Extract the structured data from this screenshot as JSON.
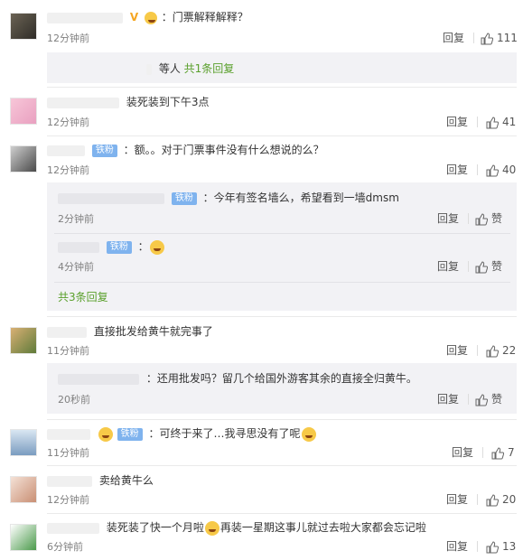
{
  "c1": {
    "text": "：门票解释解释？",
    "time": "12分钟前",
    "reply": "回复",
    "likes": "111",
    "more": "等人",
    "more_link": "共1条回复",
    "v_label": "V"
  },
  "c2": {
    "text": "装死装到下午3点",
    "time": "12分钟前",
    "reply": "回复",
    "likes": "41"
  },
  "c3": {
    "badge": "铁粉",
    "text": "：额。。对于门票事件没有什么想说的么？",
    "time": "12分钟前",
    "reply": "回复",
    "likes": "40",
    "replies": [
      {
        "badge": "铁粉",
        "text": "：今年有签名墙么，希望看到一墙dmsm",
        "time": "2分钟前",
        "reply": "回复",
        "like": "赞"
      },
      {
        "badge": "铁粉",
        "text": "：",
        "time": "4分钟前",
        "reply": "回复",
        "like": "赞"
      }
    ],
    "total": "共3条回复"
  },
  "c4": {
    "text": "直接批发给黄牛就完事了",
    "time": "11分钟前",
    "reply": "回复",
    "likes": "22",
    "sub": {
      "text": "：还用批发吗？留几个给国外游客其余的直接全归黄牛。",
      "time": "20秒前",
      "reply": "回复",
      "like": "赞"
    }
  },
  "c5": {
    "badge": "铁粉",
    "text": "：可终于来了…我寻思没有了呢",
    "time": "11分钟前",
    "reply": "回复",
    "likes": "7"
  },
  "c6": {
    "text": "卖给黄牛么",
    "time": "12分钟前",
    "reply": "回复",
    "likes": "20"
  },
  "c7": {
    "text_a": "装死装了快一个月啦",
    "text_b": "再装一星期这事儿就过去啦大家都会忘记啦",
    "time": "6分钟前",
    "reply": "回复",
    "likes": "13"
  },
  "colors": {
    "link": "#5aa02c",
    "fan_badge": "#7fb3ee",
    "bg_sub": "#f2f2f5"
  }
}
